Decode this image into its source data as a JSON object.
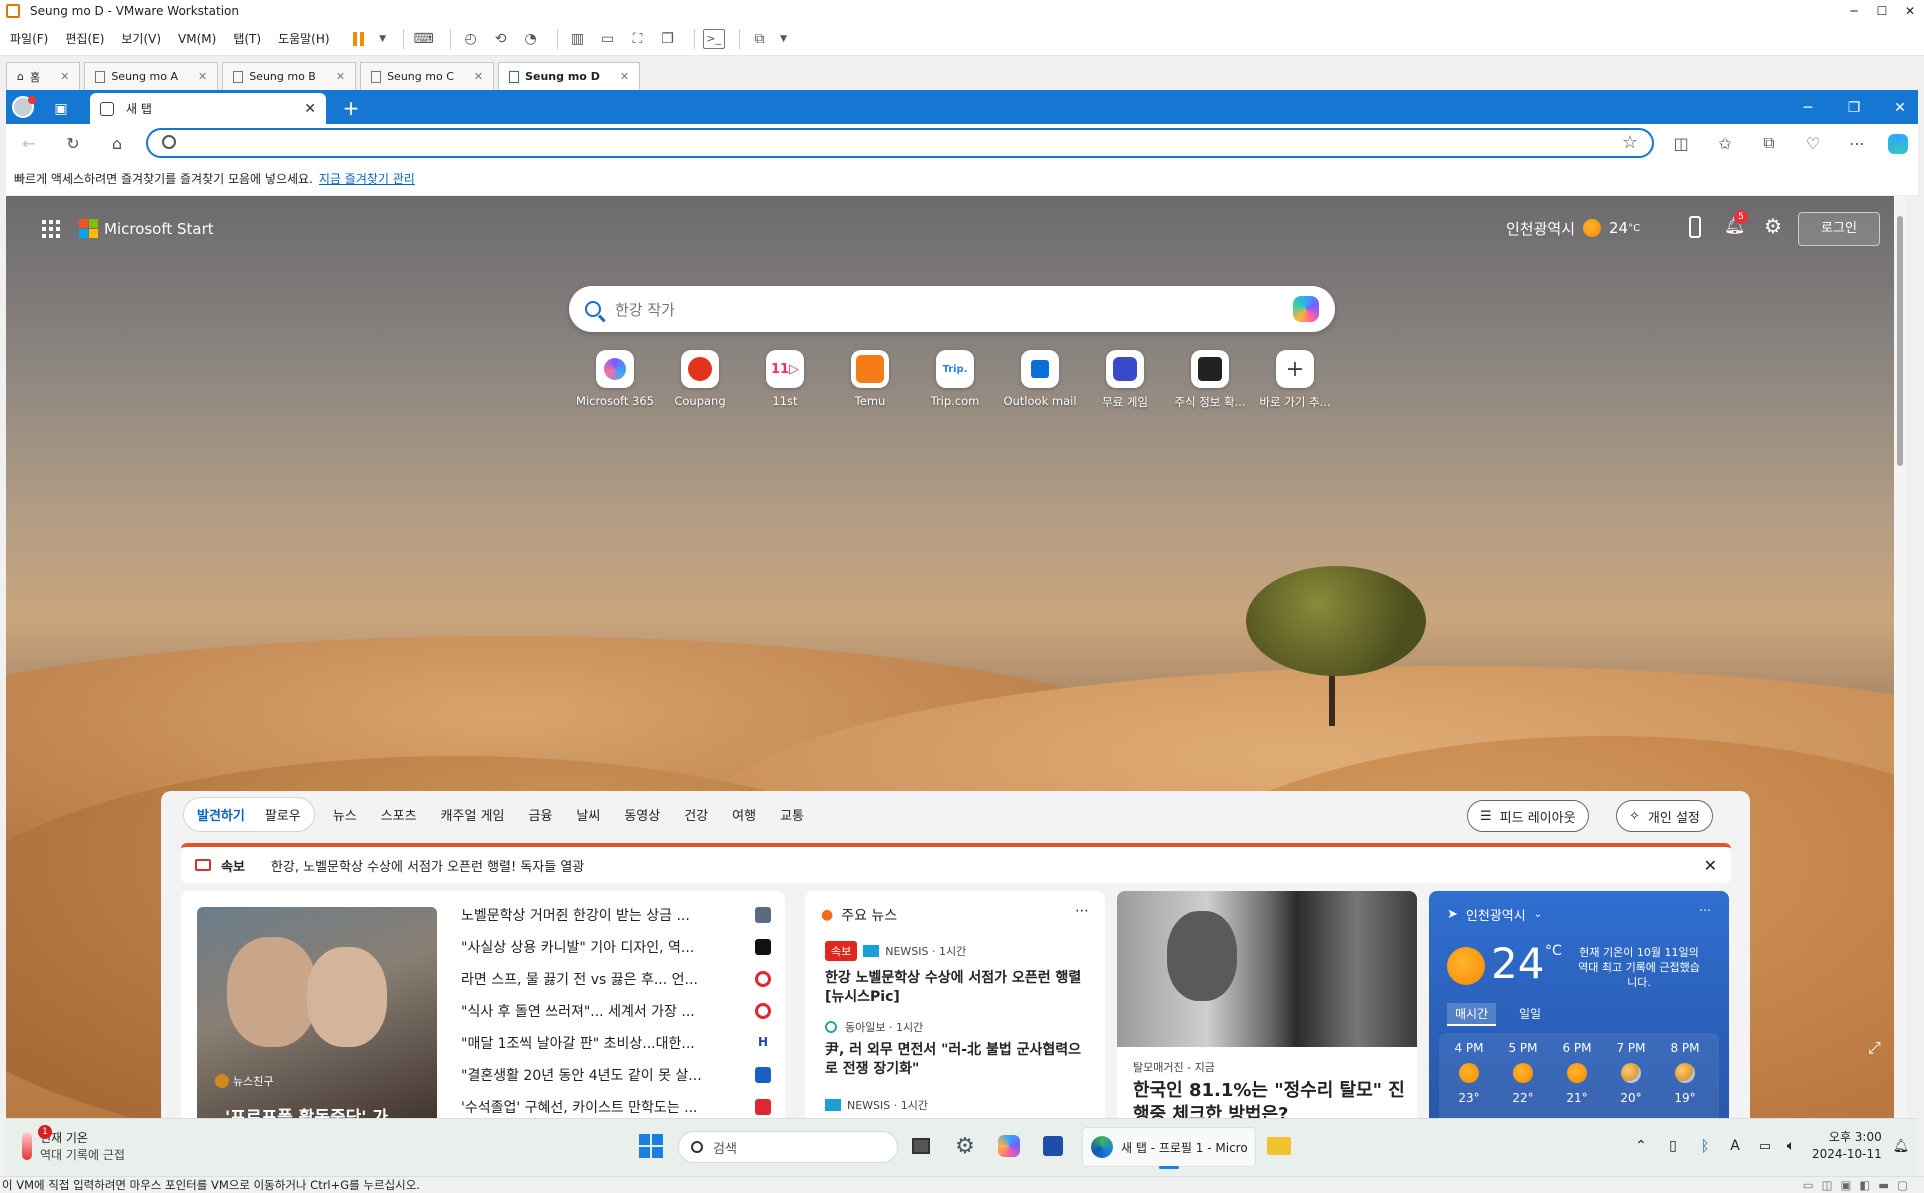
{
  "vmware": {
    "title": "Seung mo D - VMware Workstation",
    "menu": [
      "파일(F)",
      "편집(E)",
      "보기(V)",
      "VM(M)",
      "탭(T)",
      "도움말(H)"
    ],
    "tabs": [
      {
        "label": "홈"
      },
      {
        "label": "Seung mo A"
      },
      {
        "label": "Seung mo B"
      },
      {
        "label": "Seung mo C"
      },
      {
        "label": "Seung mo D"
      }
    ],
    "status": "이 VM에 직접 입력하려면 마우스 포인터를 VM으로 이동하거나 Ctrl+G를 누르십시오."
  },
  "edge": {
    "tab_label": "새 탭",
    "favbar_text": "빠르게 액세스하려면 즐겨찾기를 즐겨찾기 모음에 넣으세요.",
    "favbar_link": "지금 즐겨찾기 관리"
  },
  "start": {
    "brand": "Microsoft Start",
    "location": "인천광역시",
    "temp": "24",
    "temp_unit": "°C",
    "notification_count": "5",
    "login": "로그인",
    "search_placeholder": "한강 작가",
    "quick_links": [
      {
        "label": "Microsoft 365",
        "icon": "microsoft365-icon",
        "color": "#7b5cff"
      },
      {
        "label": "Coupang",
        "icon": "coupang-icon",
        "color": "#e0341d"
      },
      {
        "label": "11st",
        "icon": "11st-icon",
        "color": "#ff2f5a"
      },
      {
        "label": "Temu",
        "icon": "temu-icon",
        "color": "#f57b18"
      },
      {
        "label": "Trip.com",
        "icon": "trip-icon",
        "color": "#2a7ef0"
      },
      {
        "label": "Outlook mail",
        "icon": "outlook-icon",
        "color": "#0a6fd6"
      },
      {
        "label": "무료 게임",
        "icon": "games-icon",
        "color": "#3a4bc9"
      },
      {
        "label": "주식 정보 확...",
        "icon": "stocks-icon",
        "color": "#222"
      },
      {
        "label": "바로 가기 추...",
        "icon": "add-icon",
        "color": "#444"
      }
    ]
  },
  "feed": {
    "nav_active": "발견하기",
    "nav_follow": "팔로우",
    "nav_items": [
      "뉴스",
      "스포츠",
      "캐주얼 게임",
      "금융",
      "날씨",
      "동영상",
      "건강",
      "여행",
      "교통"
    ],
    "layout_btn": "피드 레이아웃",
    "personalize_btn": "개인 설정",
    "breaking_label": "속보",
    "breaking_text": "한강, 노벨문학상 수상에 서점가 오픈런 행렬! 독자들 열광",
    "hero_source": "뉴스친구",
    "hero_title": "'프로포폴 활동중단' 가",
    "headlines": [
      {
        "text": "노벨문학상 거머쥔 한강이 받는 상금 ...",
        "color": "#5a6b7f"
      },
      {
        "text": "\"사실상 상용 카니발\" 기아 디자인, 역...",
        "color": "#111"
      },
      {
        "text": "라면 스프, 물 끓기 전 vs 끓은 후... 언...",
        "color": "#e0262e"
      },
      {
        "text": "\"식사 후 돌연 쓰러져\"... 세계서 가장 ...",
        "color": "#e0262e"
      },
      {
        "text": "\"매달 1조씩 날아갈 판\" 초비상...대한...",
        "color": "#1a4aa0"
      },
      {
        "text": "\"결혼생활 20년 동안 4년도 같이 못 살...",
        "color": "#1a5fc4"
      },
      {
        "text": "'수석졸업' 구혜선, 카이스트 만학도는 ...",
        "color": "#e0262e"
      }
    ],
    "top_news": {
      "title": "주요 뉴스",
      "items": [
        {
          "chip": "속보",
          "source": "NEWSIS",
          "time": "1시간",
          "text": "한강 노벨문학상 수상에 서점가 오픈런 행렬 [뉴시스Pic]"
        },
        {
          "source": "동아일보",
          "time": "1시간",
          "text": "尹, 러 외무 면전서 \"러-北 불법 군사협력으로 전쟁 장기화\""
        },
        {
          "source": "NEWSIS",
          "time": "1시간",
          "text": ""
        }
      ]
    },
    "story": {
      "source": "탈모매거진",
      "time": "지금",
      "title": "한국인 81.1%는 \"정수리 탈모\" 진행중 체크한 방법은?"
    },
    "weather": {
      "location": "인천광역시",
      "temp": "24",
      "unit": "°C",
      "note": "현재 기온이 10월 11일의 역대 최고 기록에 근접했습니다.",
      "tab_hourly": "매시간",
      "tab_daily": "일일",
      "hours": [
        {
          "time": "4 PM",
          "temp": "23°",
          "icon": "sun"
        },
        {
          "time": "5 PM",
          "temp": "22°",
          "icon": "sun"
        },
        {
          "time": "6 PM",
          "temp": "21°",
          "icon": "sun"
        },
        {
          "time": "7 PM",
          "temp": "20°",
          "icon": "moon"
        },
        {
          "time": "8 PM",
          "temp": "19°",
          "icon": "moon"
        }
      ]
    }
  },
  "taskbar": {
    "weather_title": "현재 기온",
    "weather_sub": "역대 기록에 근접",
    "weather_badge": "1",
    "search": "검색",
    "edge_window": "새 탭 - 프로필 1 - Micro",
    "time": "오후 3:00",
    "date": "2024-10-11"
  }
}
